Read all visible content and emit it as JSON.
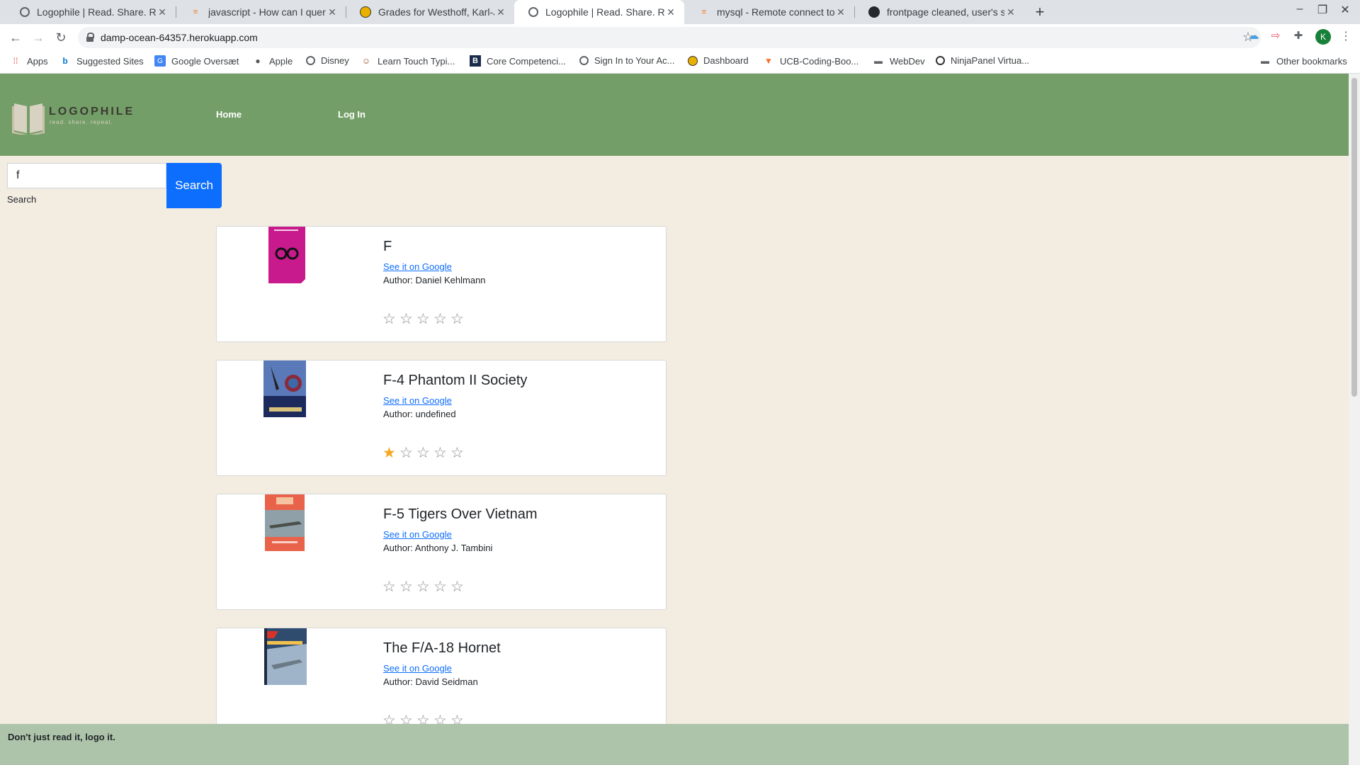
{
  "browser": {
    "tabs": [
      {
        "title": "Logophile | Read. Share. Repeat.",
        "active": false,
        "icon": "globe-icon"
      },
      {
        "title": "javascript - How can I query a",
        "active": false,
        "icon": "stackoverflow-icon"
      },
      {
        "title": "Grades for Westhoff, Karl-Johan",
        "active": false,
        "icon": "canvas-icon"
      },
      {
        "title": "Logophile | Read. Share. Repeat.",
        "active": true,
        "icon": "globe-icon"
      },
      {
        "title": "mysql - Remote connect to clear",
        "active": false,
        "icon": "stackoverflow-icon"
      },
      {
        "title": "frontpage cleaned, user's stars",
        "active": false,
        "icon": "github-icon"
      }
    ],
    "url": "damp-ocean-64357.herokuapp.com",
    "profile_initial": "K",
    "bookmarks": [
      {
        "label": "Apps",
        "icon": "apps-grid-icon"
      },
      {
        "label": "Suggested Sites",
        "icon": "bing-icon"
      },
      {
        "label": "Google Oversæt",
        "icon": "translate-icon"
      },
      {
        "label": "Apple",
        "icon": "apple-icon"
      },
      {
        "label": "Disney",
        "icon": "globe-icon"
      },
      {
        "label": "Learn Touch Typi...",
        "icon": "typing-icon"
      },
      {
        "label": "Core Competenci...",
        "icon": "b-icon"
      },
      {
        "label": "Sign In to Your Ac...",
        "icon": "globe-icon"
      },
      {
        "label": "Dashboard",
        "icon": "canvas-icon"
      },
      {
        "label": "UCB-Coding-Boo...",
        "icon": "gitlab-icon"
      },
      {
        "label": "WebDev",
        "icon": "folder-icon"
      },
      {
        "label": "NinjaPanel Virtua...",
        "icon": "power-icon"
      }
    ],
    "other_bookmarks": "Other bookmarks"
  },
  "site": {
    "logo_name": "LOGOPHILE",
    "logo_tagline": "read. share. repeat.",
    "nav": {
      "home": "Home",
      "login": "Log In"
    },
    "search": {
      "value": "f",
      "button": "Search",
      "label": "Search"
    },
    "footer": "Don't just read it, logo it."
  },
  "books": [
    {
      "title": "F",
      "link": "See it on Google",
      "author": "Author: Daniel Kehlmann",
      "rating": 0,
      "cover_color": "#c81a8c"
    },
    {
      "title": "F-4 Phantom II Society",
      "link": "See it on Google",
      "author": "Author: undefined",
      "rating": 1,
      "cover_color": "#1c2a5c"
    },
    {
      "title": "F-5 Tigers Over Vietnam",
      "link": "See it on Google",
      "author": "Author: Anthony J. Tambini",
      "rating": 0,
      "cover_color": "#e8634a"
    },
    {
      "title": "The F/A-18 Hornet",
      "link": "See it on Google",
      "author": "Author: David Seidman",
      "rating": 0,
      "cover_color": "#2f4b6e"
    }
  ],
  "colors": {
    "header": "#739e67",
    "page_bg": "#f2ece1",
    "footer": "#adc4aa",
    "button": "#0d6efd",
    "star_on": "#f4a91f"
  }
}
